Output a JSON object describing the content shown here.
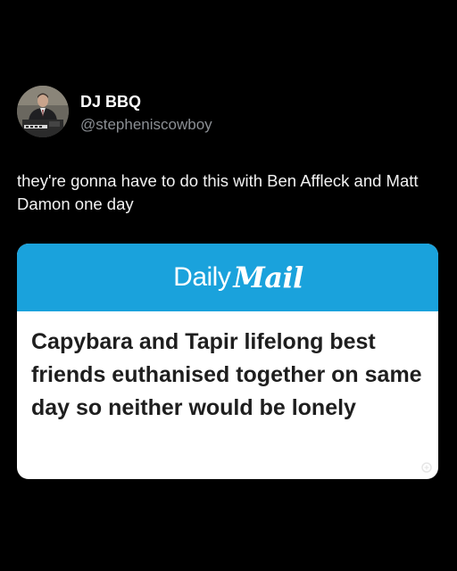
{
  "tweet": {
    "author": {
      "display_name": "DJ BBQ",
      "handle": "@stepheniscowboy",
      "avatar_icon": "profile-photo"
    },
    "text": "they're gonna have to do this with Ben Affleck and Matt Damon one day"
  },
  "embed": {
    "masthead": {
      "daily": "Daily",
      "mail": "Mail",
      "color": "#1aa2dc"
    },
    "headline": "Capybara and Tapir lifelong best friends euthanised together on same day so neither would be lonely"
  },
  "colors": {
    "background": "#000000",
    "text": "#ffffff",
    "handle": "#8b8f94",
    "headline": "#1e1e1e"
  }
}
